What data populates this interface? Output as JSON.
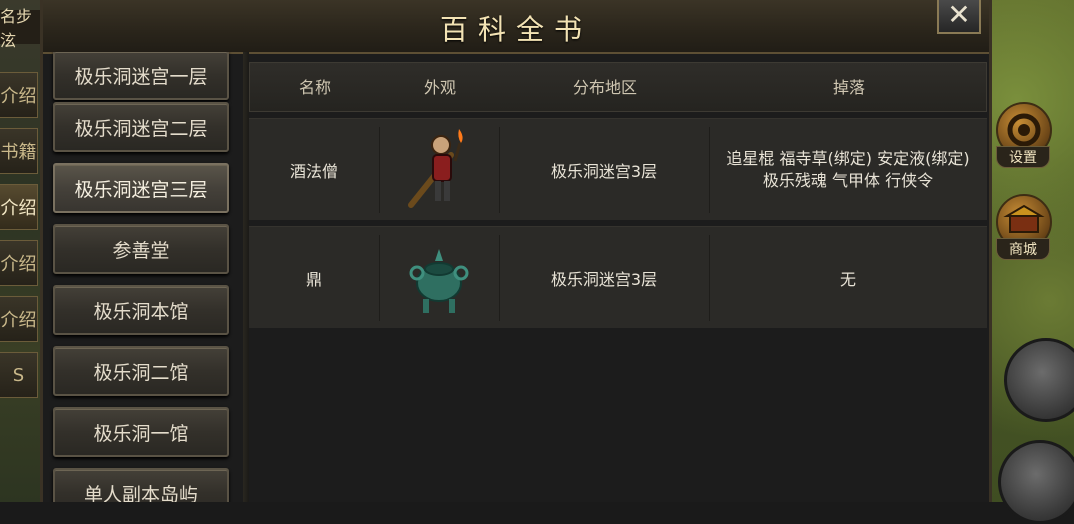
{
  "window": {
    "title": "百科全书",
    "close_label": "✕"
  },
  "left_edge": {
    "top_label": "名步泫",
    "tabs": [
      "介绍",
      "书籍",
      "介绍",
      "介绍",
      "介绍",
      "S"
    ]
  },
  "right_edge": {
    "buttons": [
      {
        "label": "设置",
        "icon": "gear-icon"
      },
      {
        "label": "商城",
        "icon": "shop-icon"
      }
    ]
  },
  "categories": {
    "items": [
      "极乐洞迷宫一层",
      "极乐洞迷宫二层",
      "极乐洞迷宫三层",
      "参善堂",
      "极乐洞本馆",
      "极乐洞二馆",
      "极乐洞一馆",
      "单人副本岛屿"
    ],
    "active_index": 2
  },
  "table": {
    "headers": {
      "name": "名称",
      "appearance": "外观",
      "region": "分布地区",
      "drops": "掉落"
    },
    "rows": [
      {
        "name": "酒法僧",
        "appearance_icon": "monk-monster-icon",
        "region": "极乐洞迷宫3层",
        "drops_line1": "追星棍 福寺草(绑定) 安定液(绑定)",
        "drops_line2": "极乐残魂 气甲体 行侠令"
      },
      {
        "name": "鼎",
        "appearance_icon": "bronze-cauldron-monster-icon",
        "region": "极乐洞迷宫3层",
        "drops_line1": "无",
        "drops_line2": ""
      }
    ]
  },
  "colors": {
    "panel_bg": "#1c1c1c",
    "row_bg": "#2b2a27",
    "title_text": "#f3e3b4",
    "cauldron_green": "#3f8f7e"
  }
}
